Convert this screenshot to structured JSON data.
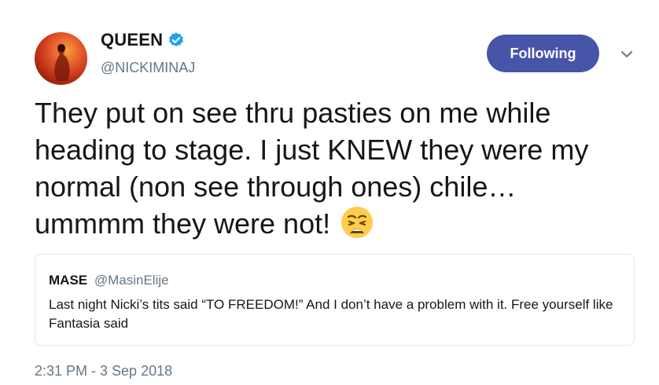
{
  "author": {
    "display_name": "QUEEN",
    "handle": "@NICKIMINAJ",
    "verified": true
  },
  "follow_button": {
    "label": "Following"
  },
  "tweet": {
    "text": "They put on see thru pasties on me while heading to stage. I just KNEW they were my normal (non see through ones) chile… ummmm they were not!",
    "emoji": "weary-face-icon"
  },
  "quoted_tweet": {
    "name": "MASE",
    "handle": "@MasinElije",
    "text": "Last night Nicki’s tits said “TO FREEDOM!” And I don’t have a problem with it. Free yourself like Fantasia said"
  },
  "timestamp": "2:31 PM - 3 Sep 2018",
  "colors": {
    "follow_button_bg": "#4655a8",
    "verified_badge": "#1da1f2",
    "secondary_text": "#657786",
    "border": "#e1e8ed"
  }
}
